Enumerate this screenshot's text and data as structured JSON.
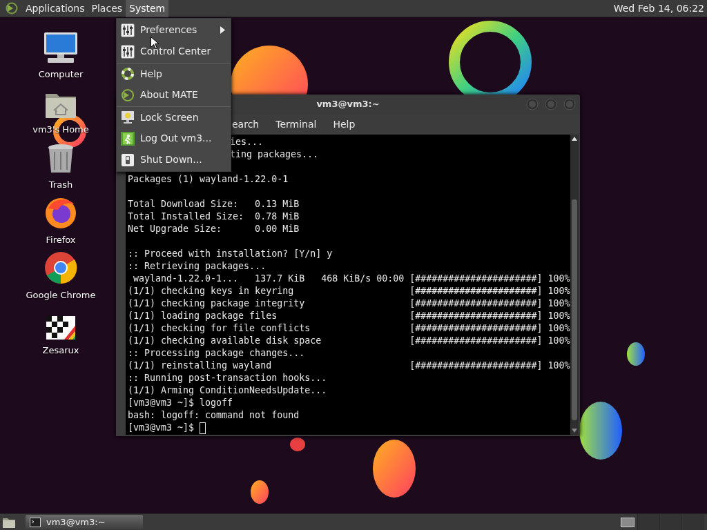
{
  "top_panel": {
    "menus": [
      {
        "label": "Applications",
        "selected": false
      },
      {
        "label": "Places",
        "selected": false
      },
      {
        "label": "System",
        "selected": true
      }
    ],
    "clock": "Wed Feb 14, 06:22"
  },
  "desktop_icons": [
    {
      "label": "Computer"
    },
    {
      "label": "vm3's Home"
    },
    {
      "label": "Trash"
    },
    {
      "label": "Firefox"
    },
    {
      "label": "Google Chrome"
    },
    {
      "label": "Zesarux"
    }
  ],
  "system_menu": {
    "items": [
      {
        "label": "Preferences",
        "submenu": true,
        "separator_before": false
      },
      {
        "label": "Control Center",
        "submenu": false,
        "separator_before": false
      },
      {
        "label": "Help",
        "submenu": false,
        "separator_before": true
      },
      {
        "label": "About MATE",
        "submenu": false,
        "separator_before": false
      },
      {
        "label": "Lock Screen",
        "submenu": false,
        "separator_before": true
      },
      {
        "label": "Log Out vm3...",
        "submenu": false,
        "separator_before": false
      },
      {
        "label": "Shut Down...",
        "submenu": false,
        "separator_before": false
      }
    ]
  },
  "terminal": {
    "title": "vm3@vm3:~",
    "menu": [
      "earch",
      "Terminal",
      "Help"
    ],
    "lines": [
      {
        "text": "ies...",
        "kind": "cut",
        "gap_before": false
      },
      {
        "text": "ting packages...",
        "kind": "cut",
        "gap_before": false
      },
      {
        "text": "Packages (1) wayland-1.22.0-1",
        "kind": "full",
        "gap_before": true
      },
      {
        "text": "Total Download Size:   0.13 MiB",
        "kind": "full",
        "gap_before": true
      },
      {
        "text": "Total Installed Size:  0.78 MiB",
        "kind": "full",
        "gap_before": false
      },
      {
        "text": "Net Upgrade Size:      0.00 MiB",
        "kind": "full",
        "gap_before": false
      },
      {
        "text": ":: Proceed with installation? [Y/n] y",
        "kind": "full",
        "gap_before": true
      },
      {
        "text": ":: Retrieving packages...",
        "kind": "full",
        "gap_before": false
      },
      {
        "text": " wayland-1.22.0-1...   137.7 KiB   468 KiB/s 00:00 [######################] 100%",
        "kind": "full",
        "gap_before": false
      },
      {
        "text": "(1/1) checking keys in keyring                     [######################] 100%",
        "kind": "full",
        "gap_before": false
      },
      {
        "text": "(1/1) checking package integrity                   [######################] 100%",
        "kind": "full",
        "gap_before": false
      },
      {
        "text": "(1/1) loading package files                        [######################] 100%",
        "kind": "full",
        "gap_before": false
      },
      {
        "text": "(1/1) checking for file conflicts                  [######################] 100%",
        "kind": "full",
        "gap_before": false
      },
      {
        "text": "(1/1) checking available disk space                [######################] 100%",
        "kind": "full",
        "gap_before": false
      },
      {
        "text": ":: Processing package changes...",
        "kind": "full",
        "gap_before": false
      },
      {
        "text": "(1/1) reinstalling wayland                         [######################] 100%",
        "kind": "full",
        "gap_before": false
      },
      {
        "text": ":: Running post-transaction hooks...",
        "kind": "full",
        "gap_before": false
      },
      {
        "text": "(1/1) Arming ConditionNeedsUpdate...",
        "kind": "full",
        "gap_before": false
      },
      {
        "text": "[vm3@vm3 ~]$ logoff",
        "kind": "full",
        "gap_before": false
      },
      {
        "text": "bash: logoff: command not found",
        "kind": "full",
        "gap_before": false
      }
    ],
    "prompt": "[vm3@vm3 ~]$"
  },
  "bottom_panel": {
    "tasks": [
      {
        "label": "vm3@vm3:~",
        "selected": false
      }
    ]
  }
}
